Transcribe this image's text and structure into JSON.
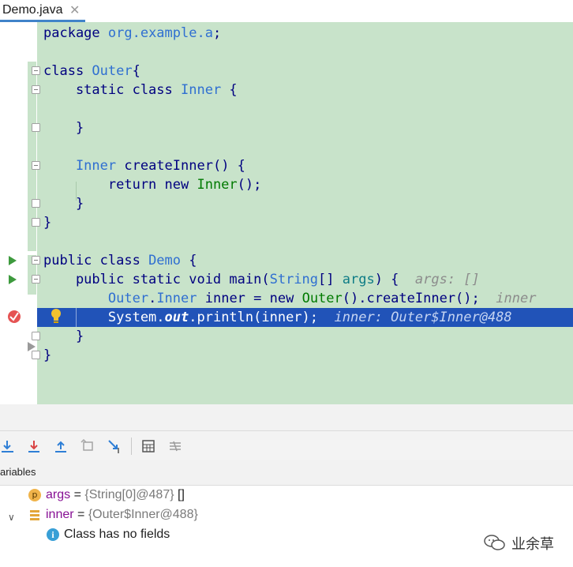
{
  "tab": {
    "label": "Demo.java",
    "close": "✕"
  },
  "code": {
    "lines": {
      "l1": {
        "kw": "package ",
        "pkg": "org.example.a",
        "end": ";"
      },
      "l3": {
        "kw": "class ",
        "cls": "Outer",
        "end": "{"
      },
      "l4": {
        "kw": "    static class ",
        "cls": "Inner",
        "end": " {"
      },
      "l6": {
        "text": "    }"
      },
      "l8": {
        "cls": "    Inner ",
        "name": "createInner",
        "end": "() {"
      },
      "l9": {
        "kw": "        return new ",
        "green": "Inner",
        "end": "();"
      },
      "l10": {
        "text": "    }"
      },
      "l11": {
        "text": "}"
      },
      "l13": {
        "kw": "public class ",
        "cls": "Demo",
        "end": " {"
      },
      "l14": {
        "kw": "    public static void ",
        "name": "main(",
        "cls": "String",
        "mid": "[] ",
        "teal": "args",
        "end": ") {",
        "hint": "args: []"
      },
      "l15": {
        "cls1": "        Outer",
        "dot": ".",
        "cls2": "Inner",
        "name": " inner = ",
        "kw": "new ",
        "green": "Outer",
        "call": "().createInner();",
        "hint": "inner"
      },
      "l16": {
        "a": "        System.",
        "b": "out",
        "c": ".println(inner);",
        "hint": "inner: Outer$Inner@488"
      },
      "l17": {
        "text": "    }"
      },
      "l18": {
        "text": "}"
      }
    }
  },
  "variables": {
    "title": "ariables",
    "rows": [
      {
        "badge": "p",
        "name": "args",
        "eq": " = ",
        "value": "{String[0]@487}",
        "extra": " []"
      },
      {
        "toggle": "∨",
        "name": "inner",
        "eq": " = ",
        "value": "{Outer$Inner@488}"
      },
      {
        "badge": "i",
        "text": "Class has no fields"
      }
    ]
  },
  "watermark": {
    "text": "业余草"
  },
  "colors": {
    "accent": "#4083c9",
    "coverage": "#c8e3ca",
    "current_line": "#2153b8",
    "breakpoint": "#e55353"
  }
}
